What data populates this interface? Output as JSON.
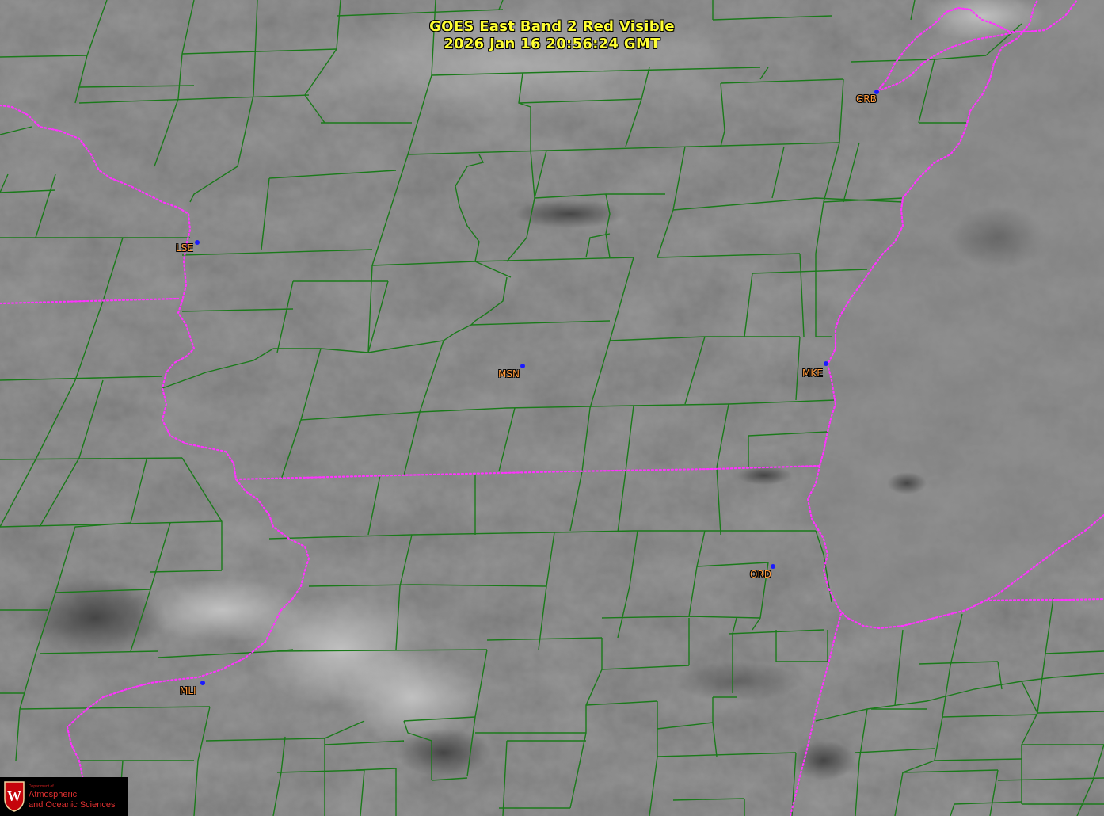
{
  "title": {
    "line1": "GOES East Band 2 Red Visible",
    "line2": "2026 Jan 16  20:56:24 GMT"
  },
  "stations": [
    {
      "id": "LSE"
    },
    {
      "id": "GRB"
    },
    {
      "id": "MSN"
    },
    {
      "id": "MKE"
    },
    {
      "id": "ORD"
    },
    {
      "id": "MLI"
    }
  ],
  "logo": {
    "line1": "Department of",
    "line2": "Atmospheric",
    "line3": "and Oceanic Sciences",
    "crest_letter": "W"
  },
  "colors": {
    "county_lines": "#1a7a1a",
    "state_lines": "#ff33ff",
    "title_text": "#ffff33",
    "station_label": "#ff9a3c",
    "station_dot": "#1a1aff",
    "logo_red": "#c5050c"
  }
}
